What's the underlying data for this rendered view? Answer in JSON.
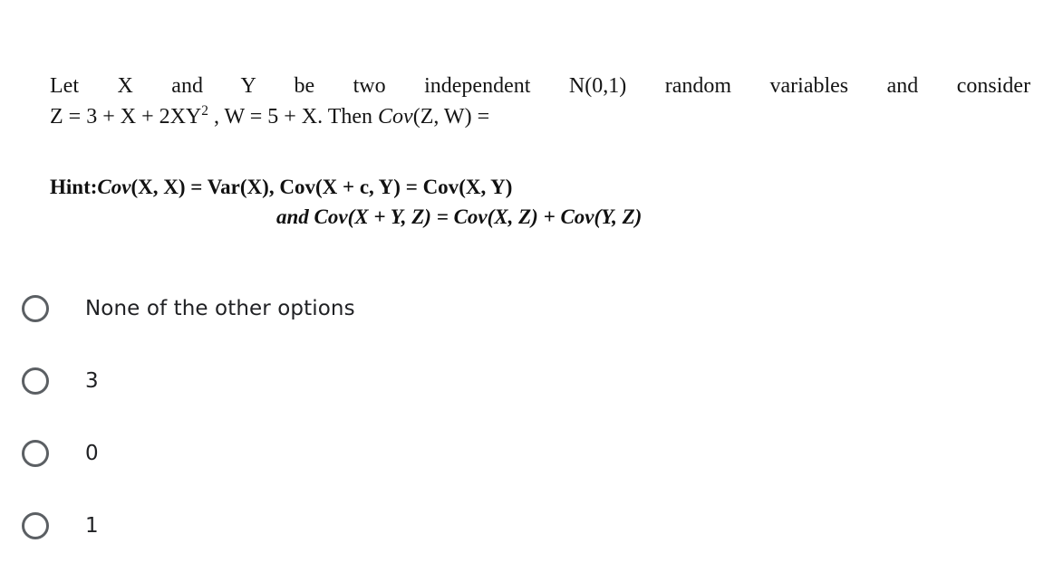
{
  "question": {
    "line1_parts": [
      "Let",
      "X",
      "and",
      "Y",
      "be",
      "two",
      "independent",
      "N(0,1)",
      "random",
      "variables",
      "and",
      "consider"
    ],
    "line1_plain": "Let X and Y be two independent N(0,1) random variables and consider",
    "line2_pre": "Z = 3 + X + 2XY",
    "line2_exponent": "2",
    "line2_mid": " , W = 5 + X. Then ",
    "line2_cov": "Cov",
    "line2_post": "(Z, W) ="
  },
  "hint": {
    "label": "Hint:",
    "line1_cov1": "Cov",
    "line1_arg1": "(X, X) = ",
    "line1_var": "Var(X),  ",
    "line1_cov2": "Cov",
    "line1_arg2": "(X + c, Y) = ",
    "line1_cov3": "Cov",
    "line1_arg3": "(X, Y)",
    "line1_plain": "Hint:Cov(X, X) = Var(X),  Cov(X + c, Y) = Cov(X, Y)",
    "line2_and": "and ",
    "line2_cov1": "Cov",
    "line2_arg1": "(X + Y, Z) = ",
    "line2_cov2": "Cov",
    "line2_arg2": "(X, Z) + ",
    "line2_cov3": "Cov",
    "line2_arg3": "(Y, Z)",
    "line2_plain": "and Cov(X + Y, Z) = Cov(X, Z) + Cov(Y, Z)"
  },
  "options": [
    {
      "label": "None of the other options",
      "selected": false
    },
    {
      "label": "3",
      "selected": false
    },
    {
      "label": "0",
      "selected": false
    },
    {
      "label": "1",
      "selected": false
    }
  ],
  "colors": {
    "background": "#ffffff",
    "text": "#141414",
    "option_text": "#202124",
    "radio_border": "#5b5f63",
    "radio_selected": "#1a73e8"
  }
}
